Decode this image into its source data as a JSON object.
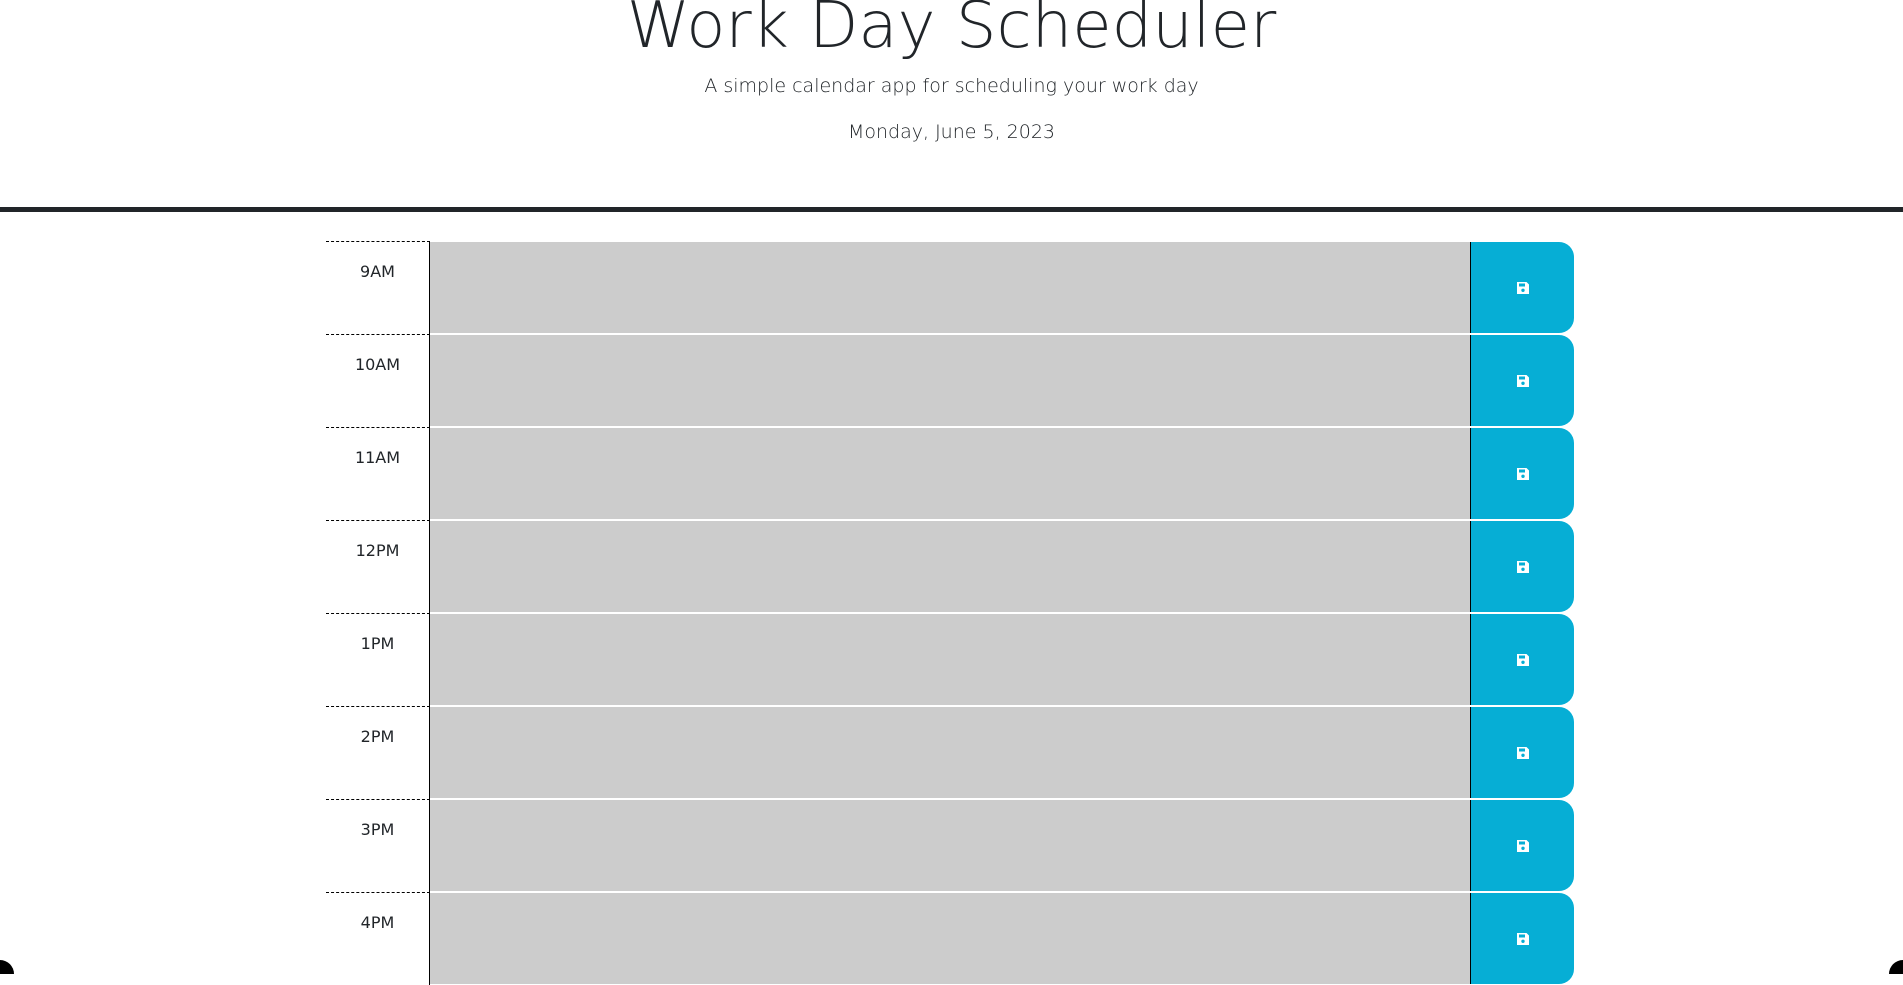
{
  "header": {
    "title": "Work Day Scheduler",
    "lead": "A simple calendar app for scheduling your work day",
    "current_day": "Monday, June 5, 2023"
  },
  "colors": {
    "past": "#cccccc",
    "save_button": "#06aed5",
    "header_rule": "#212529"
  },
  "save_icon": "floppy-disk-icon",
  "time_blocks": [
    {
      "hour": "9AM",
      "description": ""
    },
    {
      "hour": "10AM",
      "description": ""
    },
    {
      "hour": "11AM",
      "description": ""
    },
    {
      "hour": "12PM",
      "description": ""
    },
    {
      "hour": "1PM",
      "description": ""
    },
    {
      "hour": "2PM",
      "description": ""
    },
    {
      "hour": "3PM",
      "description": ""
    },
    {
      "hour": "4PM",
      "description": ""
    }
  ]
}
